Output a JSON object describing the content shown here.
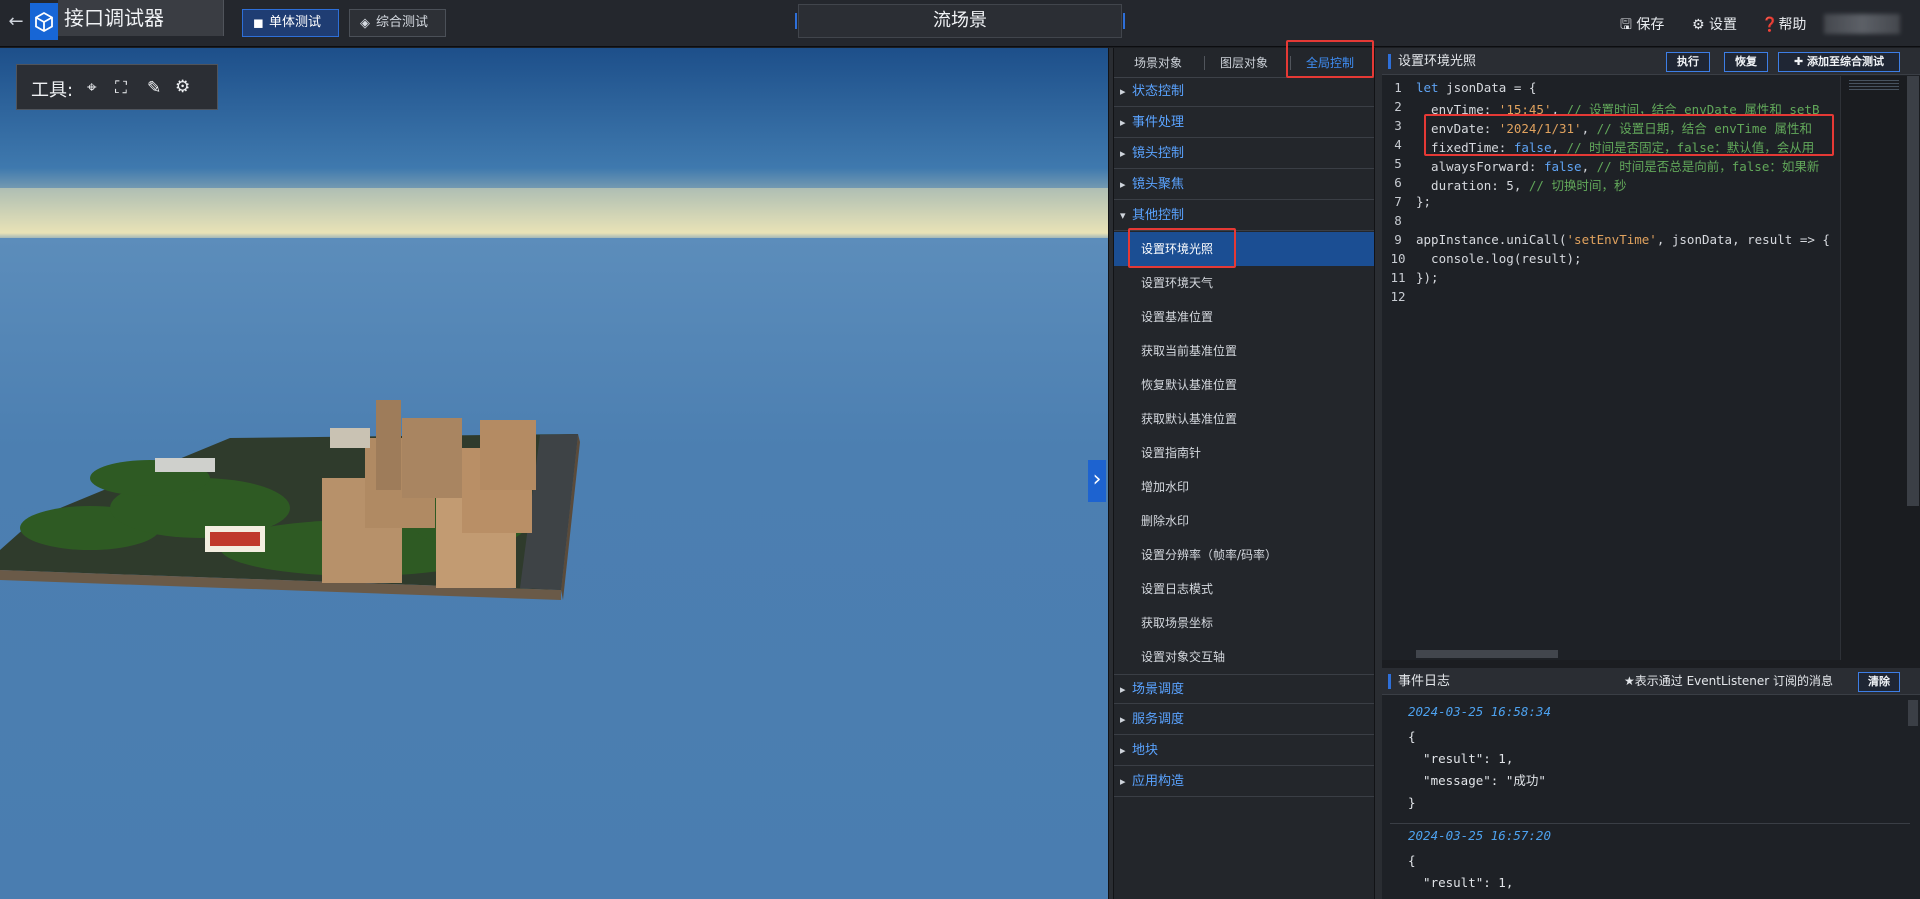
{
  "header": {
    "app_title": "接口调试器",
    "tabs": [
      "单体测试",
      "综合测试"
    ],
    "scene_title": "流场景",
    "links": {
      "save": "保存",
      "settings": "设置",
      "help": "帮助"
    }
  },
  "viewport": {
    "tools_label": "工具:"
  },
  "tree": {
    "tabs": [
      "场景对象",
      "图层对象",
      "全局控制"
    ],
    "groups": [
      "状态控制",
      "事件处理",
      "镜头控制",
      "镜头聚焦",
      "其他控制",
      "场景调度",
      "服务调度",
      "地块",
      "应用构造"
    ],
    "other_items": [
      "设置环境光照",
      "设置环境天气",
      "设置基准位置",
      "获取当前基准位置",
      "恢复默认基准位置",
      "获取默认基准位置",
      "设置指南针",
      "增加水印",
      "删除水印",
      "设置分辨率（帧率/码率）",
      "设置日志模式",
      "获取场景坐标",
      "设置对象交互轴"
    ]
  },
  "editor": {
    "title": "设置环境光照",
    "buttons": {
      "run": "执行",
      "restore": "恢复",
      "add": "添加至综合测试"
    },
    "line_numbers": [
      "1",
      "2",
      "3",
      "4",
      "5",
      "6",
      "7",
      "8",
      "9",
      "10",
      "11",
      "12"
    ],
    "lines": [
      {
        "a": "let",
        "b": " jsonData = {"
      },
      {
        "b": "  envTime: ",
        "s": "'15:45'",
        "c": ", ",
        "m": "// 设置时间，结合 envDate 属性和 setB"
      },
      {
        "b": "  envDate: ",
        "s": "'2024/1/31'",
        "c": ", ",
        "m": "// 设置日期，结合 envTime 属性和"
      },
      {
        "b": "  fixedTime: ",
        "k": "false",
        "c": ", ",
        "m": "// 时间是否固定，false：默认值，会从用"
      },
      {
        "b": "  alwaysForward: ",
        "k": "false",
        "c": ", ",
        "m": "// 时间是否总是向前，false：如果新"
      },
      {
        "b": "  duration: 5, ",
        "m": "// 切换时间，秒"
      },
      {
        "b": "};"
      },
      {
        "b": ""
      },
      {
        "b": "appInstance.uniCall(",
        "s": "'setEnvTime'",
        "c": ", jsonData, result => {"
      },
      {
        "b": "  console.log(result);"
      },
      {
        "b": "});"
      },
      {
        "b": ""
      }
    ]
  },
  "log": {
    "title": "事件日志",
    "note": "★表示通过 EventListener 订阅的消息",
    "clear": "清除",
    "entries": [
      {
        "time": "2024-03-25 16:58:34",
        "json": "{\n  \"result\": 1,\n  \"message\": \"成功\"\n}"
      },
      {
        "time": "2024-03-25 16:57:20",
        "json": "{\n  \"result\": 1,"
      }
    ]
  }
}
